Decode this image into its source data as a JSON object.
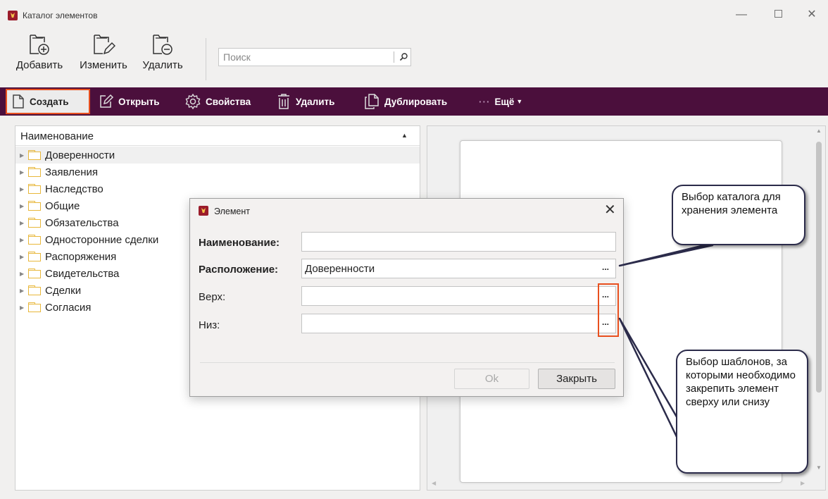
{
  "window": {
    "title": "Каталог элементов",
    "controls": {
      "minimize": "—",
      "close": "✕"
    }
  },
  "ribbon": {
    "add_label": "Добавить",
    "edit_label": "Изменить",
    "delete_label": "Удалить",
    "search_placeholder": "Поиск"
  },
  "toolbar": {
    "create": "Создать",
    "open": "Открыть",
    "properties": "Свойства",
    "delete": "Удалить",
    "duplicate": "Дублировать",
    "more_dots": "···",
    "more": "Ещё"
  },
  "tree": {
    "column_header": "Наименование",
    "items": [
      "Доверенности",
      "Заявления",
      "Наследство",
      "Общие",
      "Обязательства",
      "Односторонние сделки",
      "Распоряжения",
      "Свидетельства",
      "Сделки",
      "Согласия"
    ],
    "selected_index": 0
  },
  "dialog": {
    "title": "Элемент",
    "close": "✕",
    "name_label": "Наименование:",
    "name_value": "",
    "location_label": "Расположение:",
    "location_value": "Доверенности",
    "top_label": "Верх:",
    "top_value": "",
    "bottom_label": "Низ:",
    "bottom_value": "",
    "browse": "...",
    "ok": "Ok",
    "close_button": "Закрыть"
  },
  "callouts": {
    "catalog": "Выбор каталога для хранения элемента",
    "templates": "Выбор шаблонов, за которыми необходимо закрепить элемент сверху или снизу"
  },
  "colors": {
    "toolbar_bg": "#4b0f3c",
    "highlight": "#e8501f",
    "folder": "#e8b73a",
    "callout_border": "#2b2b4a"
  }
}
